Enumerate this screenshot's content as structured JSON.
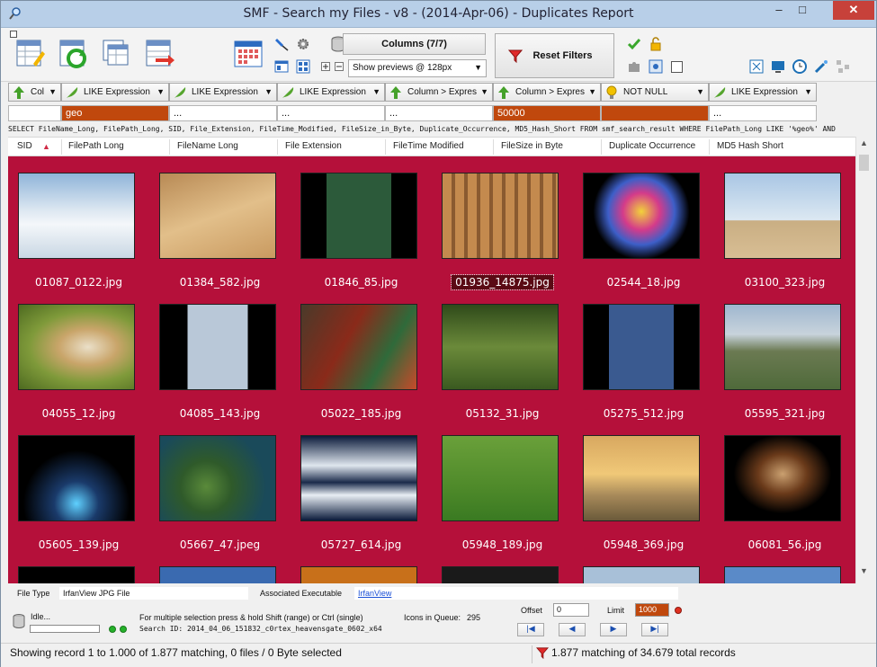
{
  "window": {
    "title": "SMF - Search my Files - v8 - (2014-Apr-06) - Duplicates Report",
    "minimize": "–",
    "maximize": "□",
    "close": "✕"
  },
  "toolbar": {
    "columns_button": "Columns (7/7)",
    "reset_filters_button": "Reset Filters",
    "preview_select": "Show previews @ 128px",
    "icons": [
      "report-edit-icon",
      "refresh-icon",
      "tables-icon",
      "export-icon",
      "calendar-icon",
      "pin-icon",
      "gear-icon",
      "database-icon",
      "filter-icon",
      "check-icon",
      "lock-icon",
      "puzzle-icon",
      "settings-icon",
      "window-icon",
      "monitor-icon",
      "clock-icon",
      "magic-wand-icon",
      "tree-icon"
    ]
  },
  "filters": [
    {
      "label": "Col",
      "icon": "arrow-up-icon"
    },
    {
      "label": "LIKE Expression",
      "icon": "feather-icon"
    },
    {
      "label": "LIKE Expression",
      "icon": "feather-icon"
    },
    {
      "label": "LIKE Expression",
      "icon": "feather-icon"
    },
    {
      "label": "Column > Expres",
      "icon": "arrow-up-icon"
    },
    {
      "label": "Column > Expres",
      "icon": "arrow-up-icon"
    },
    {
      "label": "NOT NULL",
      "icon": "bulb-icon"
    },
    {
      "label": "LIKE Expression",
      "icon": "feather-icon"
    }
  ],
  "filter_values": [
    "",
    "geo",
    "...",
    "...",
    "...",
    "50000",
    "",
    "..."
  ],
  "sql": "SELECT FileName_Long, FilePath_Long, SID, File_Extension, FileTime_Modified, FileSize_in_Byte, Duplicate_Occurrence, MD5_Hash_Short FROM smf_search_result WHERE FilePath_Long LIKE '%geo%' AND",
  "columns": [
    "SID",
    "FilePath Long",
    "FileName Long",
    "File Extension",
    "FileTime Modified",
    "FileSize in Byte",
    "Duplicate Occurrence",
    "MD5 Hash Short"
  ],
  "sort_indicator": "▲",
  "files": [
    "01087_0122.jpg",
    "01384_582.jpg",
    "01846_85.jpg",
    "01936_14875.jpg",
    "02544_18.jpg",
    "03100_323.jpg",
    "04055_12.jpg",
    "04085_143.jpg",
    "05022_185.jpg",
    "05132_31.jpg",
    "05275_512.jpg",
    "05595_321.jpg",
    "05605_139.jpg",
    "05667_47.jpeg",
    "05727_614.jpg",
    "05948_189.jpg",
    "05948_369.jpg",
    "06081_56.jpg"
  ],
  "selected_file": "01936_14875.jpg",
  "info": {
    "file_type_label": "File Type",
    "file_type_value": "IrfanView JPG File",
    "assoc_label": "Associated Executable",
    "assoc_value": "IrfanView"
  },
  "status": {
    "idle": "Idle...",
    "hint": "For multiple selection press & hold Shift (range) or Ctrl (single)",
    "search_id": "Search  ID: 2014_04_06_151832_c0rtex_heavensgate_0602_x64",
    "queue_label": "Icons in Queue:",
    "queue_value": "295",
    "offset_label": "Offset",
    "offset_value": "0",
    "limit_label": "Limit",
    "limit_value": "1000"
  },
  "statusbar": {
    "left": "Showing record 1 to 1.000 of 1.877 matching, 0 files / 0 Byte selected",
    "right": "1.877 matching of 34.679 total records"
  },
  "colors": {
    "grid_bg": "#b5103a",
    "active_filter": "#c0480d"
  }
}
